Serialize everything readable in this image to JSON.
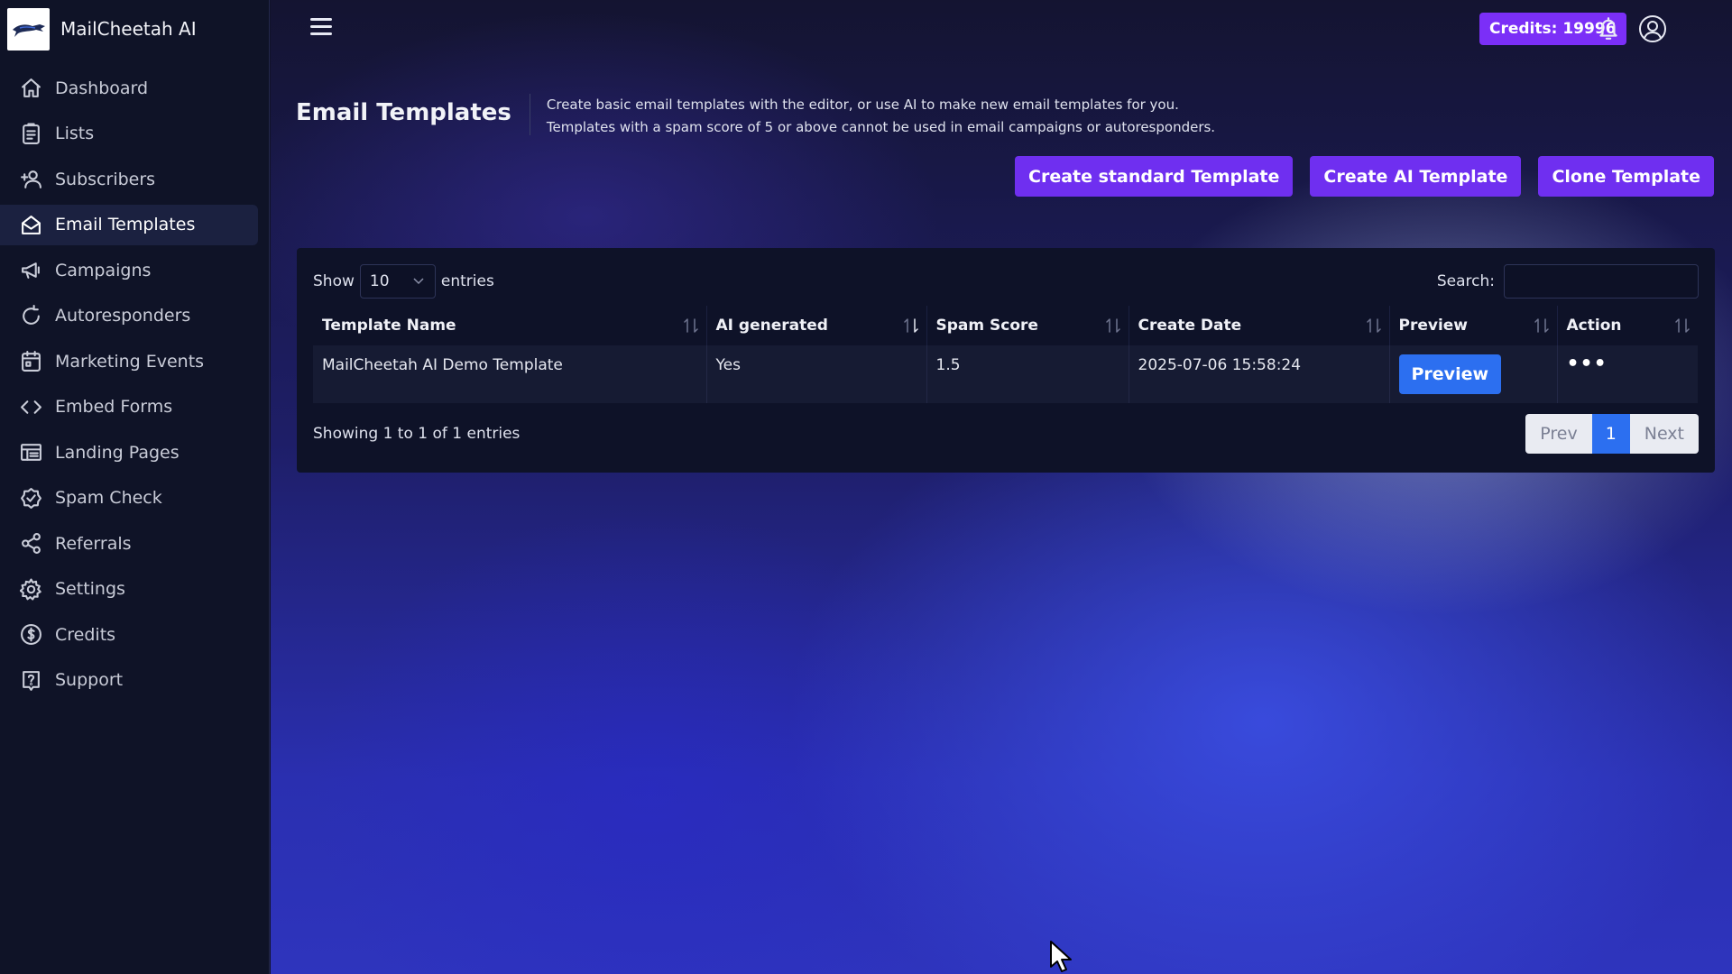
{
  "app": {
    "name": "MailCheetah AI"
  },
  "sidebar": {
    "items": [
      {
        "label": "Dashboard",
        "icon": "home-icon"
      },
      {
        "label": "Lists",
        "icon": "list-icon"
      },
      {
        "label": "Subscribers",
        "icon": "add-user-icon"
      },
      {
        "label": "Email Templates",
        "icon": "envelope-open-icon",
        "active": true
      },
      {
        "label": "Campaigns",
        "icon": "megaphone-icon"
      },
      {
        "label": "Autoresponders",
        "icon": "refresh-icon"
      },
      {
        "label": "Marketing Events",
        "icon": "calendar-icon"
      },
      {
        "label": "Embed Forms",
        "icon": "code-icon"
      },
      {
        "label": "Landing Pages",
        "icon": "layout-icon"
      },
      {
        "label": "Spam Check",
        "icon": "badge-check-icon"
      },
      {
        "label": "Referrals",
        "icon": "share-icon"
      },
      {
        "label": "Settings",
        "icon": "gear-icon"
      },
      {
        "label": "Credits",
        "icon": "dollar-circle-icon"
      },
      {
        "label": "Support",
        "icon": "help-icon"
      }
    ]
  },
  "topbar": {
    "credits_label": "Credits: 19996"
  },
  "page": {
    "title": "Email Templates",
    "description_line1": "Create basic email templates with the editor, or use AI to make new email templates for you.",
    "description_line2": "Templates with a spam score of 5 or above cannot be used in email campaigns or autoresponders."
  },
  "actions": {
    "create_standard": "Create standard Template",
    "create_ai": "Create AI Template",
    "clone": "Clone Template"
  },
  "table": {
    "show_label": "Show",
    "entries_value": "10",
    "entries_label": "entries",
    "search_label": "Search:",
    "search_value": "",
    "columns": [
      "Template Name",
      "AI generated",
      "Spam Score",
      "Create Date",
      "Preview",
      "Action"
    ],
    "rows": [
      {
        "template_name": "MailCheetah AI Demo Template",
        "ai_generated": "Yes",
        "spam_score": "1.5",
        "create_date": "2025-07-06 15:58:24",
        "preview_label": "Preview",
        "action_label": "•••"
      }
    ],
    "info": "Showing 1 to 1 of 1 entries",
    "pagination": {
      "prev": "Prev",
      "current": "1",
      "next": "Next"
    }
  },
  "colors": {
    "accent_purple": "#6f2ff0",
    "credits_purple": "#7b2ff7",
    "preview_blue": "#2c6ff0",
    "sidebar_bg": "#0f1327"
  }
}
